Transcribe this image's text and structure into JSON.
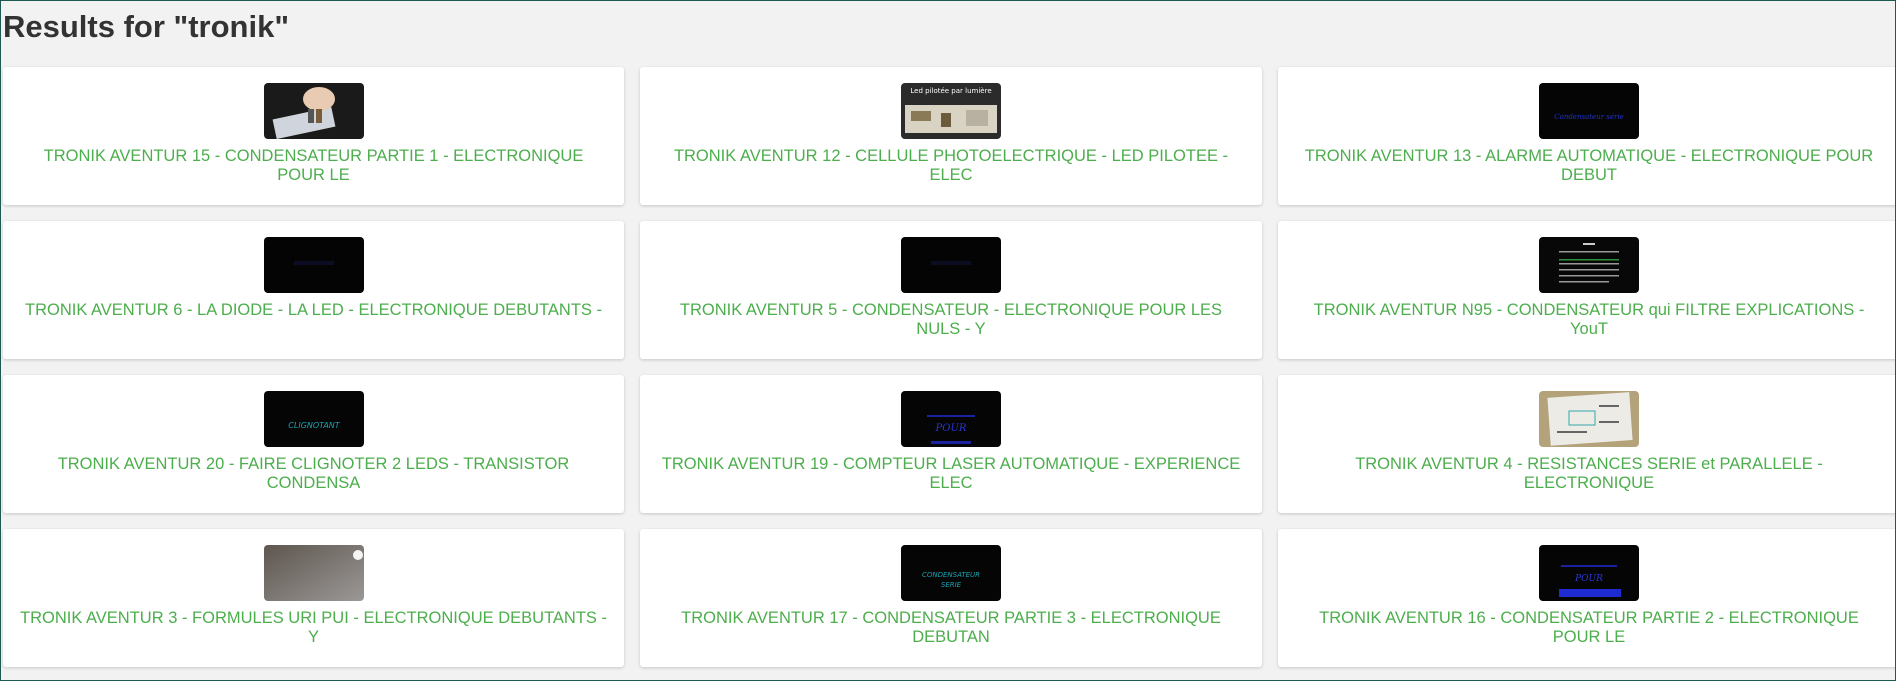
{
  "page": {
    "title": "Results for \"tronik\""
  },
  "colors": {
    "link": "#4cae4c",
    "heading": "#333333",
    "background": "#f2f2f2",
    "card": "#ffffff"
  },
  "results": [
    {
      "title": "TRONIK AVENTUR 15 - CONDENSATEUR PARTIE 1 - ELECTRONIQUE POUR LE",
      "thumb": "hand-led-photo",
      "thumb_text": ""
    },
    {
      "title": "TRONIK AVENTUR 12 - CELLULE PHOTOELECTRIQUE - LED PILOTEE - ELEC",
      "thumb": "breadboard-photo",
      "thumb_text": "Led pilotée par lumière"
    },
    {
      "title": "TRONIK AVENTUR 13 - ALARME AUTOMATIQUE - ELECTRONIQUE POUR DEBUT",
      "thumb": "dark-blue-text",
      "thumb_text": "Condensateur série"
    },
    {
      "title": "TRONIK AVENTUR 6 - LA DIODE - LA LED - ELECTRONIQUE DEBUTANTS -",
      "thumb": "dark-faint",
      "thumb_text": ""
    },
    {
      "title": "TRONIK AVENTUR 5 - CONDENSATEUR - ELECTRONIQUE POUR LES NULS - Y",
      "thumb": "dark-faint",
      "thumb_text": ""
    },
    {
      "title": "TRONIK AVENTUR N95 - CONDENSATEUR qui FILTRE EXPLICATIONS - YouT",
      "thumb": "dark-text-lines",
      "thumb_text": ""
    },
    {
      "title": "TRONIK AVENTUR 20 - FAIRE CLIGNOTER 2 LEDS - TRANSISTOR CONDENSA",
      "thumb": "dark-teal-text",
      "thumb_text": "CLIGNOTANT"
    },
    {
      "title": "TRONIK AVENTUR 19 - COMPTEUR LASER AUTOMATIQUE - EXPERIENCE ELEC",
      "thumb": "dark-blue-handwriting",
      "thumb_text": "POUR"
    },
    {
      "title": "TRONIK AVENTUR 4 - RESISTANCES SERIE et PARALLELE - ELECTRONIQUE",
      "thumb": "paper-circuit",
      "thumb_text": ""
    },
    {
      "title": "TRONIK AVENTUR 3 - FORMULES URI PUI - ELECTRONIQUE DEBUTANTS - Y",
      "thumb": "grey-light",
      "thumb_text": ""
    },
    {
      "title": "TRONIK AVENTUR 17 - CONDENSATEUR PARTIE 3 - ELECTRONIQUE DEBUTAN",
      "thumb": "dark-teal-text2",
      "thumb_text": "CONDENSATEUR SERIE"
    },
    {
      "title": "TRONIK AVENTUR 16 - CONDENSATEUR PARTIE 2 - ELECTRONIQUE POUR LE",
      "thumb": "dark-blue-big",
      "thumb_text": "POUR"
    }
  ]
}
